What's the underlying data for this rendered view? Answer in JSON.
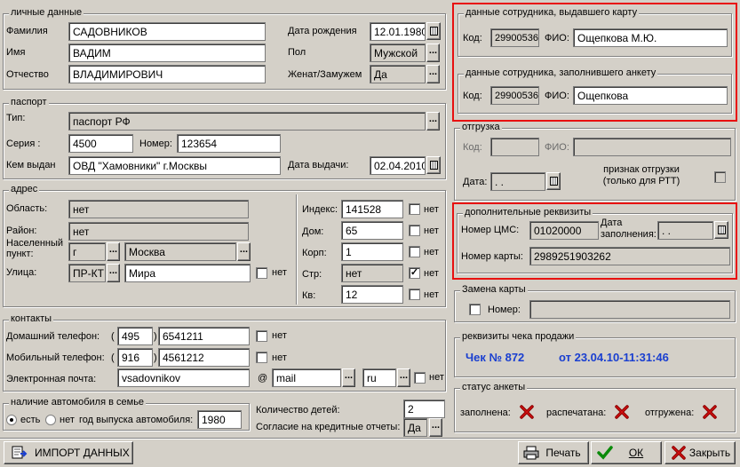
{
  "personal": {
    "title": "личные данные",
    "surname_label": "Фамилия",
    "surname": "САДОВНИКОВ",
    "name_label": "Имя",
    "name": "ВАДИМ",
    "patronymic_label": "Отчество",
    "patronymic": "ВЛАДИМИРОВИЧ",
    "birth_label": "Дата рождения",
    "birth": "12.01.1980",
    "sex_label": "Пол",
    "sex": "Мужской",
    "married_label": "Женат/Замужем",
    "married": "Да"
  },
  "passport": {
    "title": "паспорт",
    "type_label": "Тип:",
    "type": "паспорт РФ",
    "series_label": "Серия :",
    "series": "4500",
    "number_label": "Номер:",
    "number": "123654",
    "issued_label": "Кем выдан",
    "issued": "ОВД \"Хамовники\" г.Москвы",
    "issue_date_label": "Дата выдачи:",
    "issue_date": "02.04.2010"
  },
  "address": {
    "title": "адрес",
    "region_label": "Область:",
    "region": "нет",
    "district_label": "Район:",
    "district": "нет",
    "locality_label": "Населенный пункт:",
    "locality_type": "г",
    "locality": "Москва",
    "street_label": "Улица:",
    "street_type": "ПР-КТ",
    "street": "Мира",
    "street_none": "нет",
    "index_label": "Индекс:",
    "index": "141528",
    "index_none": "нет",
    "house_label": "Дом:",
    "house": "65",
    "house_none": "нет",
    "korp_label": "Корп:",
    "korp": "1",
    "korp_none": "нет",
    "str_label": "Стр:",
    "str": "нет",
    "str_none": "нет",
    "apt_label": "Кв:",
    "apt": "12",
    "apt_none": "нет"
  },
  "contacts": {
    "title": "контакты",
    "home_label": "Домашний телефон:",
    "home_code": "495",
    "home_num": "6541211",
    "home_none": "нет",
    "mobile_label": "Мобильный телефон:",
    "mobile_code": "916",
    "mobile_num": "4561212",
    "mobile_none": "нет",
    "email_label": "Электронная почта:",
    "email_user": "vsadovnikov",
    "at": "@",
    "email_domain": "mail",
    "email_zone": "ru",
    "email_none": "нет",
    "paren_open": "(",
    "paren_close": ")"
  },
  "car": {
    "title": "наличие автомобиля в семье",
    "yes": "есть",
    "no": "нет",
    "year_label": "год выпуска автомобиля:",
    "year": "1980"
  },
  "children_label": "Количество детей:",
  "children": "2",
  "credit_label": "Согласие на кредитные отчеты:",
  "credit": "Да",
  "issuer": {
    "title": "данные сотрудника, выдавшего карту",
    "code_label": "Код:",
    "code": "29900536",
    "fio_label": "ФИО:",
    "fio": "Ощепкова М.Ю."
  },
  "filler": {
    "title": "данные сотрудника, заполнившего анкету",
    "code_label": "Код:",
    "code": "29900536",
    "fio_label": "ФИО:",
    "fio": "Ощепкова"
  },
  "shipment": {
    "title": "отгрузка",
    "code_label": "Код:",
    "fio_label": "ФИО:",
    "date_label": "Дата:",
    "date": " .  .",
    "flag_label": "признак отгрузки (только для РТТ)"
  },
  "extra": {
    "title": "дополнительные реквизиты",
    "cms_label": "Номер ЦМС:",
    "cms": "01020000",
    "fill_date_label": "Дата заполнения:",
    "fill_date": " .  .",
    "card_label": "Номер карты:",
    "card": "2989251903262"
  },
  "replace": {
    "title": "Замена карты",
    "number_label": "Номер:"
  },
  "receipt": {
    "title": "реквизиты чека продажи",
    "check": "Чек № 872",
    "date": "от 23.04.10-11:31:46",
    "color": "#1a3fd0"
  },
  "status": {
    "title": "статус анкеты",
    "filled": "заполнена:",
    "printed": "распечатана:",
    "shipped": "отгружена:"
  },
  "buttons": {
    "import": "ИМПОРТ ДАННЫХ",
    "print": "Печать",
    "ok": "ОК",
    "close": "Закрыть"
  },
  "dots": "..."
}
